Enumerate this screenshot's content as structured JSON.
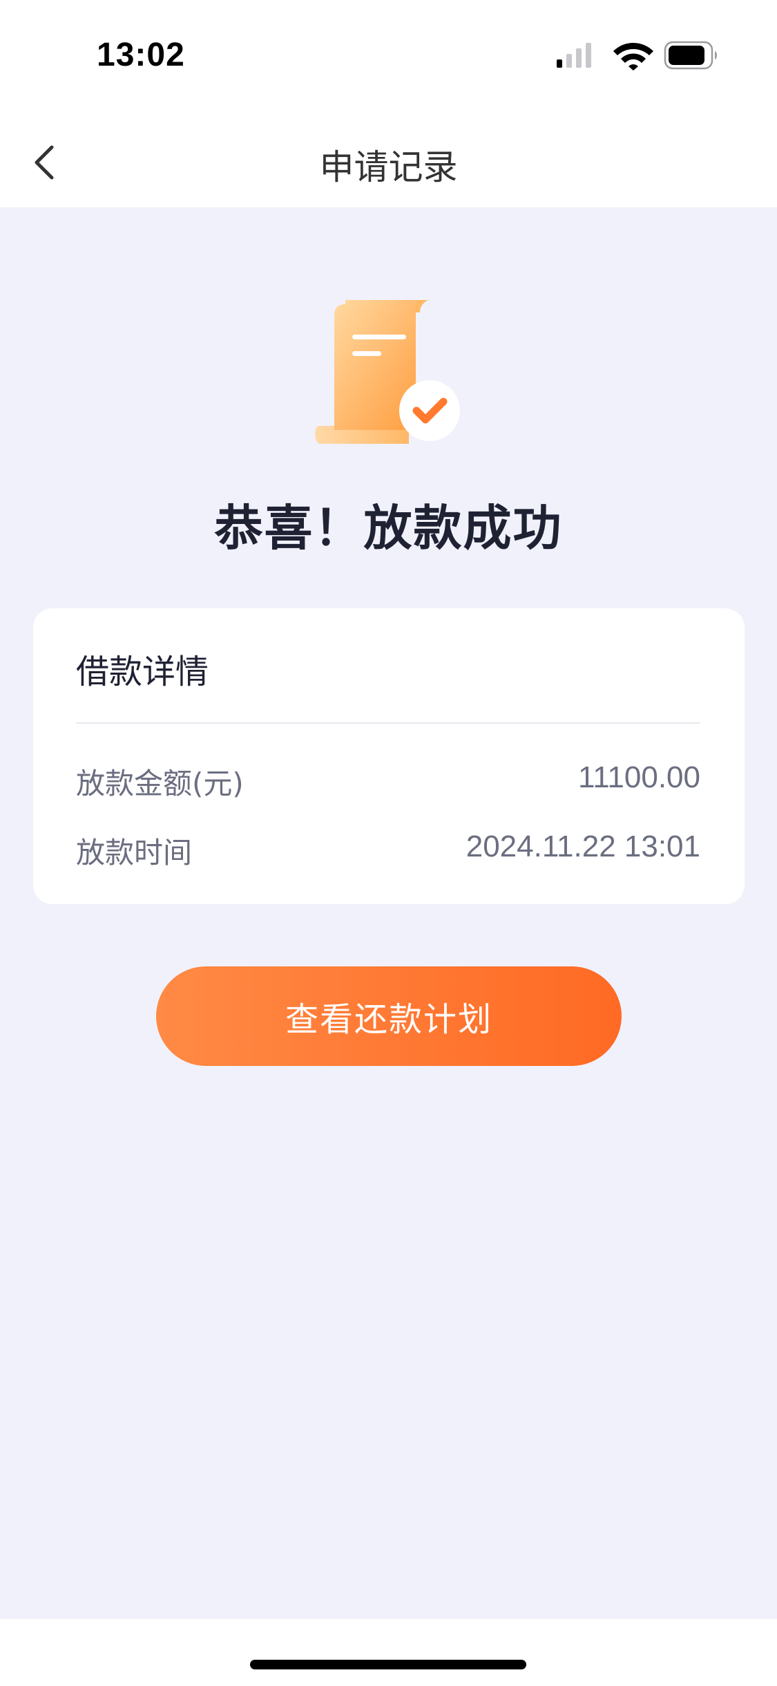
{
  "status_bar": {
    "time": "13:02"
  },
  "nav": {
    "title": "申请记录"
  },
  "hero": {
    "title": "恭喜！放款成功"
  },
  "detail_card": {
    "title": "借款详情",
    "rows": [
      {
        "label": "放款金额(元)",
        "value": "11100.00"
      },
      {
        "label": "放款时间",
        "value": "2024.11.22 13:01"
      }
    ]
  },
  "cta": {
    "label": "查看还款计划"
  },
  "colors": {
    "accent_start": "#ff8a45",
    "accent_end": "#ff6a24",
    "page_background": "#f1f1fb",
    "title_text": "#1f2233",
    "secondary_text": "#6b6e80"
  },
  "icons": {
    "back": "chevron-left-icon",
    "hero": "document-check-icon",
    "signal": "cellular-signal-icon",
    "wifi": "wifi-icon",
    "battery": "battery-icon"
  }
}
